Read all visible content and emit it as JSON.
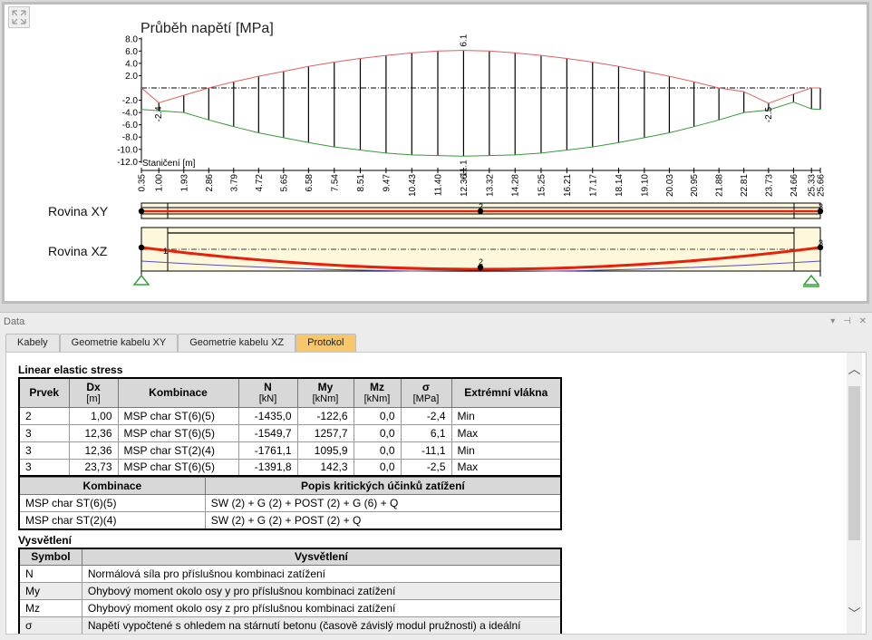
{
  "chart": {
    "title": "Průběh napětí  [MPa]",
    "yticks": [
      "8.0",
      "6.0",
      "4.0",
      "2.0",
      "-2.0",
      "-4.0",
      "-6.0",
      "-8.0",
      "-10.0",
      "-12.0"
    ],
    "x_label": "Staničení  [m]",
    "peak_labels": [
      "6.1",
      "-2.4",
      "-2.5",
      "-11.1"
    ],
    "stations": [
      "0.35",
      "1.00",
      "1.93",
      "2.86",
      "3.79",
      "4.72",
      "5.65",
      "6.58",
      "7.54",
      "8.51",
      "9.47",
      "10.43",
      "11.40",
      "12.36",
      "13.32",
      "14.28",
      "15.25",
      "16.21",
      "17.17",
      "18.14",
      "19.10",
      "20.03",
      "20.95",
      "21.88",
      "22.81",
      "23.73",
      "24.66",
      "25.33",
      "25.66"
    ],
    "plane_xy_label": "Rovina XY",
    "plane_xz_label": "Rovina XZ",
    "node_labels": [
      "1",
      "2",
      "3"
    ],
    "colors": {
      "max_line": "#e06060",
      "min_line": "#3a9a3a",
      "cable": "#e8200a",
      "beam_fill": "#fdf8dc",
      "support": "#38a038"
    }
  },
  "chart_data": {
    "type": "line",
    "title": "Průběh napětí  [MPa]",
    "xlabel": "Staničení  [m]",
    "ylabel": "",
    "ylim": [
      -12.0,
      8.0
    ],
    "x": [
      0.35,
      1.0,
      1.93,
      2.86,
      3.79,
      4.72,
      5.65,
      6.58,
      7.54,
      8.51,
      9.47,
      10.43,
      11.4,
      12.36,
      13.32,
      14.28,
      15.25,
      16.21,
      17.17,
      18.14,
      19.1,
      20.03,
      20.95,
      21.88,
      22.81,
      23.73,
      24.66,
      25.33,
      25.66
    ],
    "series": [
      {
        "values": [
          0.0,
          -2.4,
          -1.2,
          0.0,
          1.0,
          1.9,
          2.7,
          3.5,
          4.2,
          4.8,
          5.3,
          5.7,
          6.0,
          6.1,
          6.0,
          5.7,
          5.3,
          4.8,
          4.2,
          3.5,
          2.7,
          1.9,
          1.0,
          0.0,
          -0.6,
          -2.5,
          -1.0,
          0.0,
          0.0
        ]
      },
      {
        "values": [
          -3.5,
          -3.7,
          -4.0,
          -5.2,
          -6.3,
          -7.3,
          -8.1,
          -8.9,
          -9.6,
          -10.1,
          -10.6,
          -10.9,
          -11.0,
          -11.1,
          -11.0,
          -10.9,
          -10.6,
          -10.1,
          -9.6,
          -8.9,
          -8.1,
          -7.3,
          -6.3,
          -5.2,
          -4.0,
          -3.6,
          -2.3,
          -3.4,
          -3.5
        ]
      }
    ]
  },
  "data_panel": {
    "title": "Data",
    "window_controls": [
      "▾",
      "⊣",
      "✕"
    ],
    "tabs": [
      {
        "label": "Kabely",
        "active": false
      },
      {
        "label": "Geometrie kabelu XY",
        "active": false
      },
      {
        "label": "Geometrie kabelu XZ",
        "active": false
      },
      {
        "label": "Protokol",
        "active": true
      }
    ]
  },
  "stress_table": {
    "title": "Linear elastic stress",
    "headers": [
      {
        "main": "Prvek",
        "unit": ""
      },
      {
        "main": "Dx",
        "unit": "[m]"
      },
      {
        "main": "Kombinace",
        "unit": ""
      },
      {
        "main": "N",
        "unit": "[kN]"
      },
      {
        "main": "My",
        "unit": "[kNm]"
      },
      {
        "main": "Mz",
        "unit": "[kNm]"
      },
      {
        "main": "σ",
        "unit": "[MPa]"
      },
      {
        "main": "Extrémní vlákna",
        "unit": ""
      }
    ],
    "rows": [
      [
        "2",
        "1,00",
        "MSP char ST(6)(5)",
        "-1435,0",
        "-122,6",
        "0,0",
        "-2,4",
        "Min"
      ],
      [
        "3",
        "12,36",
        "MSP char ST(6)(5)",
        "-1549,7",
        "1257,7",
        "0,0",
        "6,1",
        "Max"
      ],
      [
        "3",
        "12,36",
        "MSP char ST(2)(4)",
        "-1761,1",
        "1095,9",
        "0,0",
        "-11,1",
        "Min"
      ],
      [
        "3",
        "23,73",
        "MSP char ST(6)(5)",
        "-1391,8",
        "142,3",
        "0,0",
        "-2,5",
        "Max"
      ]
    ]
  },
  "combo_table": {
    "headers": [
      "Kombinace",
      "Popis kritických účinků zatížení"
    ],
    "rows": [
      [
        "MSP char ST(6)(5)",
        "SW (2) + G (2) + POST (2) + G (6) + Q"
      ],
      [
        "MSP char ST(2)(4)",
        "SW (2) + G (2) + POST (2) + Q"
      ]
    ]
  },
  "legend": {
    "title": "Vysvětlení",
    "headers": [
      "Symbol",
      "Vysvětlení"
    ],
    "rows": [
      [
        "N",
        "Normálová síla pro příslušnou kombinaci zatížení"
      ],
      [
        "My",
        "Ohybový moment okolo osy y pro příslušnou kombinaci zatížení"
      ],
      [
        "Mz",
        "Ohybový moment okolo osy z pro příslušnou kombinaci zatížení"
      ],
      [
        "σ",
        "Napětí vypočtené s ohledem na stárnutí betonu (časově závislý modul pružnosti) a ideální"
      ]
    ]
  }
}
